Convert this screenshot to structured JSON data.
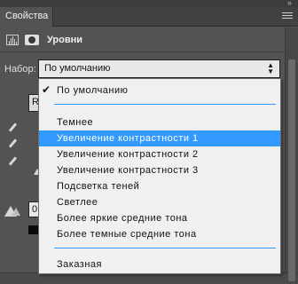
{
  "panel": {
    "tab_label": "Свойства",
    "title": "Уровни"
  },
  "preset": {
    "label": "Набор:",
    "selected": "По умолчанию"
  },
  "background": {
    "button_partial": "R",
    "field_partial": "0"
  },
  "dropdown": {
    "selected_index": 0,
    "highlighted": "Увеличение контрастности 1",
    "groups": [
      [
        "По умолчанию"
      ],
      [
        "Темнее",
        "Увеличение контрастности 1",
        "Увеличение контрастности 2",
        "Увеличение контрастности 3",
        "Подсветка теней",
        "Светлее",
        "Более яркие средние тона",
        "Более темные средние тона"
      ],
      [
        "Заказная"
      ]
    ]
  },
  "colors": {
    "highlight": "#3399ff",
    "panel_bg": "#535353",
    "list_bg": "#f0f0f0"
  }
}
